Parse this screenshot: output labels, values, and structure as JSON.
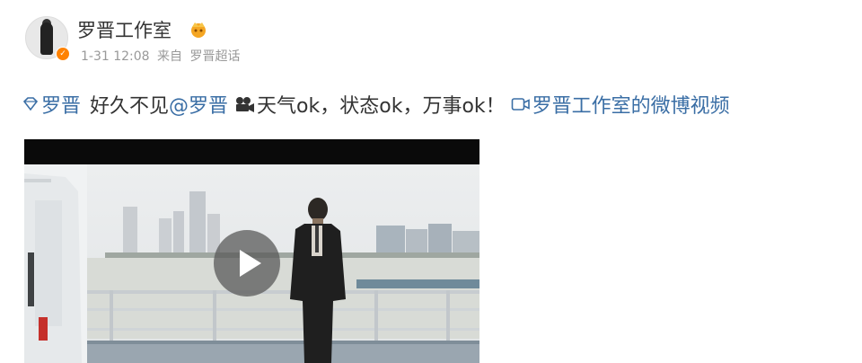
{
  "post": {
    "author": "罗晋工作室",
    "date": "1-31 12:08",
    "source_prefix": "来自",
    "source": "罗晋超话"
  },
  "text": {
    "topic": "罗晋",
    "body_1": "好久不见",
    "mention": "@罗晋",
    "body_2": "天气ok，状态ok，万事ok！",
    "video_link": "罗晋工作室的微博视频"
  },
  "colors": {
    "link": "#3a6ea5",
    "meta": "#999999",
    "verified": "#ff8200"
  },
  "icons": [
    "avatar",
    "verified-badge-icon",
    "crown-icon",
    "topic-diamond-icon",
    "film-camera-icon",
    "video-link-icon",
    "play-icon"
  ]
}
